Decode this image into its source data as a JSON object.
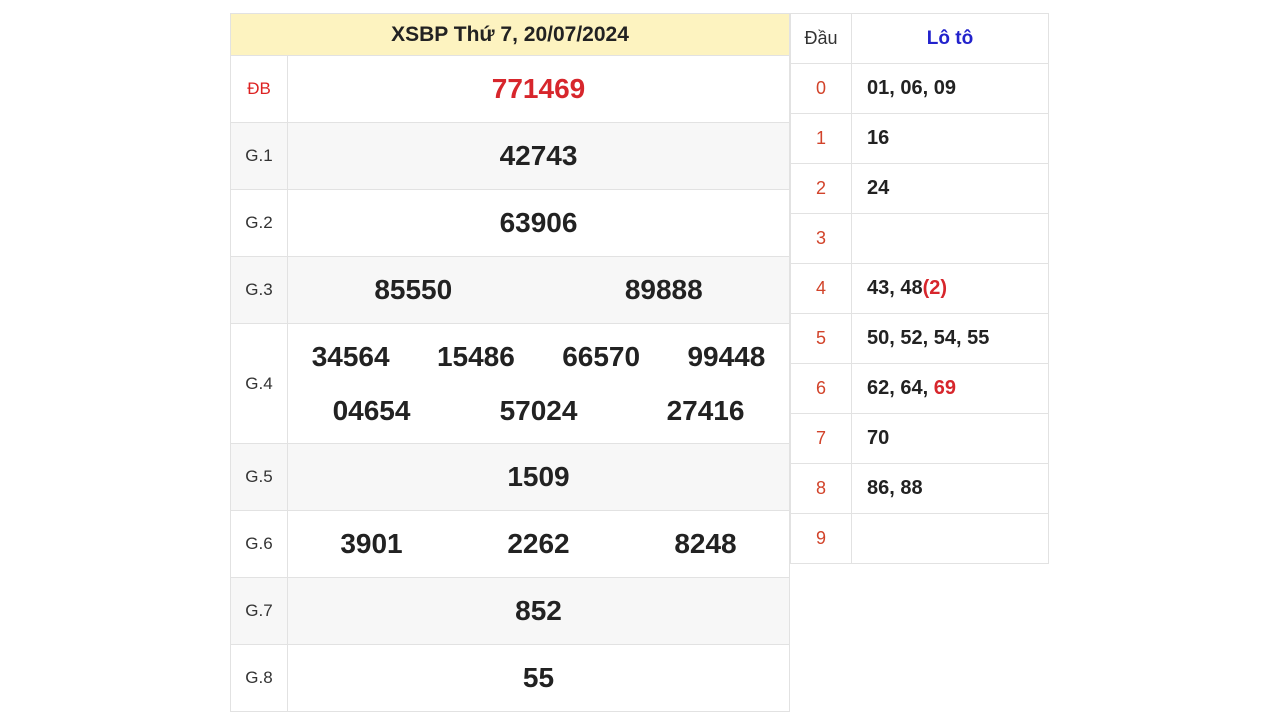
{
  "title": "XSBP Thứ 7, 20/07/2024",
  "prizes": [
    {
      "label": "ĐB",
      "numbers": [
        "771469"
      ]
    },
    {
      "label": "G.1",
      "numbers": [
        "42743"
      ]
    },
    {
      "label": "G.2",
      "numbers": [
        "63906"
      ]
    },
    {
      "label": "G.3",
      "numbers": [
        "85550",
        "89888"
      ]
    },
    {
      "label": "G.4",
      "numbers": [
        "34564",
        "15486",
        "66570",
        "99448",
        "04654",
        "57024",
        "27416"
      ]
    },
    {
      "label": "G.5",
      "numbers": [
        "1509"
      ]
    },
    {
      "label": "G.6",
      "numbers": [
        "3901",
        "2262",
        "8248"
      ]
    },
    {
      "label": "G.7",
      "numbers": [
        "852"
      ]
    },
    {
      "label": "G.8",
      "numbers": [
        "55"
      ]
    }
  ],
  "loto": {
    "header_dau": "Đầu",
    "header_loto": "Lô tô",
    "rows": [
      {
        "dau": "0",
        "values": "01, 06, 09"
      },
      {
        "dau": "1",
        "values": "16"
      },
      {
        "dau": "2",
        "values": "24"
      },
      {
        "dau": "3",
        "values": ""
      },
      {
        "dau": "4",
        "values": "43, 48",
        "extra_red": "(2)"
      },
      {
        "dau": "5",
        "values": "50, 52, 54, 55"
      },
      {
        "dau": "6",
        "values": "62, 64, ",
        "extra_red": "69"
      },
      {
        "dau": "7",
        "values": "70"
      },
      {
        "dau": "8",
        "values": "86, 88"
      },
      {
        "dau": "9",
        "values": ""
      }
    ]
  },
  "colors": {
    "accent_red": "#d7262c",
    "header_bg": "#fdf3c0",
    "loto_header": "#2222cc"
  }
}
